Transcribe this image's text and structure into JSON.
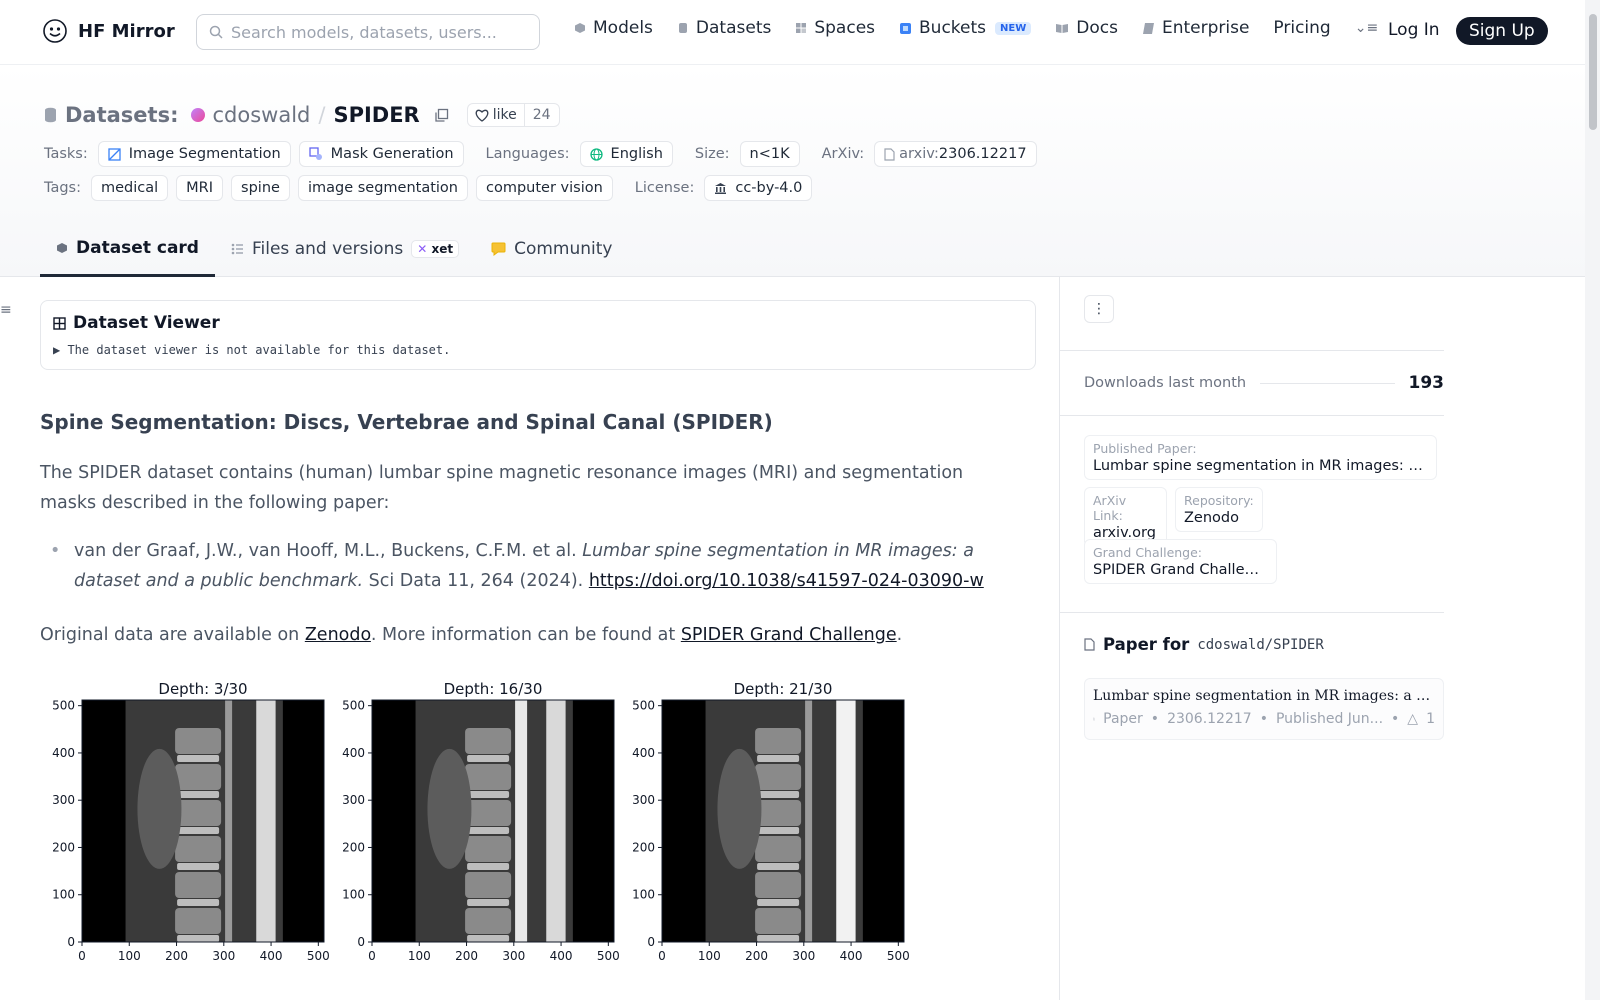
{
  "nav": {
    "brand": "HF Mirror",
    "search_placeholder": "Search models, datasets, users...",
    "links": [
      "Models",
      "Datasets",
      "Spaces",
      "Buckets",
      "Docs",
      "Enterprise",
      "Pricing"
    ],
    "new_badge": "NEW",
    "login": "Log In",
    "signup": "Sign Up"
  },
  "repo": {
    "type_label": "Datasets:",
    "owner": "cdoswald",
    "separator": "/",
    "name": "SPIDER",
    "like_label": "like",
    "like_count": "24"
  },
  "meta": {
    "tasks_label": "Tasks:",
    "tasks": [
      "Image Segmentation",
      "Mask Generation"
    ],
    "languages_label": "Languages:",
    "language": "English",
    "size_label": "Size:",
    "size": "n<1K",
    "arxiv_label": "ArXiv:",
    "arxiv_prefix": "arxiv:",
    "arxiv_id": "2306.12217",
    "tags_label": "Tags:",
    "tags": [
      "medical",
      "MRI",
      "spine",
      "image segmentation",
      "computer vision"
    ],
    "license_label": "License:",
    "license": "cc-by-4.0"
  },
  "tabs": {
    "card": "Dataset card",
    "files": "Files and versions",
    "xet": "xet",
    "community": "Community"
  },
  "viewer": {
    "title": "Dataset Viewer",
    "note": "The dataset viewer is not available for this dataset."
  },
  "content": {
    "heading": "Spine Segmentation: Discs, Vertebrae and Spinal Canal (SPIDER)",
    "intro": "The SPIDER dataset contains (human) lumbar spine magnetic resonance images (MRI) and segmentation masks described in the following paper:",
    "ref_authors": "van der Graaf, J.W., van Hooff, M.L., Buckens, C.F.M. et al. ",
    "ref_title": "Lumbar spine segmentation in MR images: a dataset and a public benchmark.",
    "ref_journal": " Sci Data 11, 264 (2024). ",
    "ref_doi": "https://doi.org/10.1038/s41597-024-03090-w",
    "avail_1": "Original data are available on ",
    "zenodo": "Zenodo",
    "avail_2": ". More information can be found at ",
    "challenge": "SPIDER Grand Challenge",
    "avail_3": "."
  },
  "figures": {
    "titles": [
      "Depth: 3/30",
      "Depth: 16/30",
      "Depth: 21/30"
    ],
    "ticks": [
      "0",
      "100",
      "200",
      "300",
      "400",
      "500"
    ]
  },
  "sidebar": {
    "downloads_label": "Downloads last month",
    "downloads_value": "193",
    "published_label": "Published Paper:",
    "published_value": "Lumbar spine segmentation in MR images: a ...",
    "arxiv_link_label": "ArXiv Link:",
    "arxiv_link_value": "arxiv.org",
    "repository_label": "Repository:",
    "repository_value": "Zenodo",
    "challenge_label": "Grand Challenge:",
    "challenge_value": "SPIDER Grand Challenge",
    "paper_for": "Paper for",
    "paper_for_repo": "cdoswald/SPIDER",
    "paper_title": "Lumbar spine segmentation in MR images: a datas...",
    "paper_type": "Paper",
    "paper_id": "2306.12217",
    "paper_date": "Published Jun...",
    "paper_upvotes": "1"
  }
}
